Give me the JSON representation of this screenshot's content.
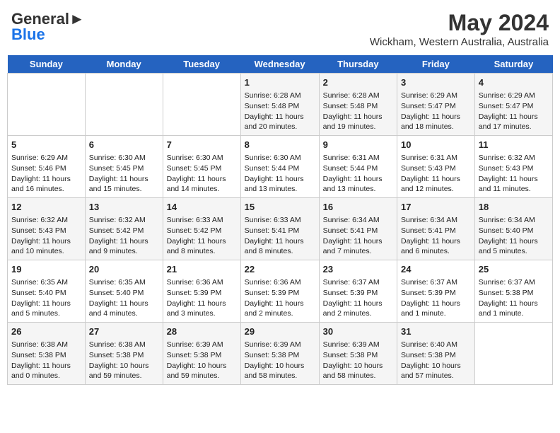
{
  "header": {
    "logo_line1": "General",
    "logo_line2": "Blue",
    "title": "May 2024",
    "subtitle": "Wickham, Western Australia, Australia"
  },
  "days_of_week": [
    "Sunday",
    "Monday",
    "Tuesday",
    "Wednesday",
    "Thursday",
    "Friday",
    "Saturday"
  ],
  "weeks": [
    [
      {
        "day": "",
        "info": ""
      },
      {
        "day": "",
        "info": ""
      },
      {
        "day": "",
        "info": ""
      },
      {
        "day": "1",
        "info": "Sunrise: 6:28 AM\nSunset: 5:48 PM\nDaylight: 11 hours and 20 minutes."
      },
      {
        "day": "2",
        "info": "Sunrise: 6:28 AM\nSunset: 5:48 PM\nDaylight: 11 hours and 19 minutes."
      },
      {
        "day": "3",
        "info": "Sunrise: 6:29 AM\nSunset: 5:47 PM\nDaylight: 11 hours and 18 minutes."
      },
      {
        "day": "4",
        "info": "Sunrise: 6:29 AM\nSunset: 5:47 PM\nDaylight: 11 hours and 17 minutes."
      }
    ],
    [
      {
        "day": "5",
        "info": "Sunrise: 6:29 AM\nSunset: 5:46 PM\nDaylight: 11 hours and 16 minutes."
      },
      {
        "day": "6",
        "info": "Sunrise: 6:30 AM\nSunset: 5:45 PM\nDaylight: 11 hours and 15 minutes."
      },
      {
        "day": "7",
        "info": "Sunrise: 6:30 AM\nSunset: 5:45 PM\nDaylight: 11 hours and 14 minutes."
      },
      {
        "day": "8",
        "info": "Sunrise: 6:30 AM\nSunset: 5:44 PM\nDaylight: 11 hours and 13 minutes."
      },
      {
        "day": "9",
        "info": "Sunrise: 6:31 AM\nSunset: 5:44 PM\nDaylight: 11 hours and 13 minutes."
      },
      {
        "day": "10",
        "info": "Sunrise: 6:31 AM\nSunset: 5:43 PM\nDaylight: 11 hours and 12 minutes."
      },
      {
        "day": "11",
        "info": "Sunrise: 6:32 AM\nSunset: 5:43 PM\nDaylight: 11 hours and 11 minutes."
      }
    ],
    [
      {
        "day": "12",
        "info": "Sunrise: 6:32 AM\nSunset: 5:43 PM\nDaylight: 11 hours and 10 minutes."
      },
      {
        "day": "13",
        "info": "Sunrise: 6:32 AM\nSunset: 5:42 PM\nDaylight: 11 hours and 9 minutes."
      },
      {
        "day": "14",
        "info": "Sunrise: 6:33 AM\nSunset: 5:42 PM\nDaylight: 11 hours and 8 minutes."
      },
      {
        "day": "15",
        "info": "Sunrise: 6:33 AM\nSunset: 5:41 PM\nDaylight: 11 hours and 8 minutes."
      },
      {
        "day": "16",
        "info": "Sunrise: 6:34 AM\nSunset: 5:41 PM\nDaylight: 11 hours and 7 minutes."
      },
      {
        "day": "17",
        "info": "Sunrise: 6:34 AM\nSunset: 5:41 PM\nDaylight: 11 hours and 6 minutes."
      },
      {
        "day": "18",
        "info": "Sunrise: 6:34 AM\nSunset: 5:40 PM\nDaylight: 11 hours and 5 minutes."
      }
    ],
    [
      {
        "day": "19",
        "info": "Sunrise: 6:35 AM\nSunset: 5:40 PM\nDaylight: 11 hours and 5 minutes."
      },
      {
        "day": "20",
        "info": "Sunrise: 6:35 AM\nSunset: 5:40 PM\nDaylight: 11 hours and 4 minutes."
      },
      {
        "day": "21",
        "info": "Sunrise: 6:36 AM\nSunset: 5:39 PM\nDaylight: 11 hours and 3 minutes."
      },
      {
        "day": "22",
        "info": "Sunrise: 6:36 AM\nSunset: 5:39 PM\nDaylight: 11 hours and 2 minutes."
      },
      {
        "day": "23",
        "info": "Sunrise: 6:37 AM\nSunset: 5:39 PM\nDaylight: 11 hours and 2 minutes."
      },
      {
        "day": "24",
        "info": "Sunrise: 6:37 AM\nSunset: 5:39 PM\nDaylight: 11 hours and 1 minute."
      },
      {
        "day": "25",
        "info": "Sunrise: 6:37 AM\nSunset: 5:38 PM\nDaylight: 11 hours and 1 minute."
      }
    ],
    [
      {
        "day": "26",
        "info": "Sunrise: 6:38 AM\nSunset: 5:38 PM\nDaylight: 11 hours and 0 minutes."
      },
      {
        "day": "27",
        "info": "Sunrise: 6:38 AM\nSunset: 5:38 PM\nDaylight: 10 hours and 59 minutes."
      },
      {
        "day": "28",
        "info": "Sunrise: 6:39 AM\nSunset: 5:38 PM\nDaylight: 10 hours and 59 minutes."
      },
      {
        "day": "29",
        "info": "Sunrise: 6:39 AM\nSunset: 5:38 PM\nDaylight: 10 hours and 58 minutes."
      },
      {
        "day": "30",
        "info": "Sunrise: 6:39 AM\nSunset: 5:38 PM\nDaylight: 10 hours and 58 minutes."
      },
      {
        "day": "31",
        "info": "Sunrise: 6:40 AM\nSunset: 5:38 PM\nDaylight: 10 hours and 57 minutes."
      },
      {
        "day": "",
        "info": ""
      }
    ]
  ]
}
